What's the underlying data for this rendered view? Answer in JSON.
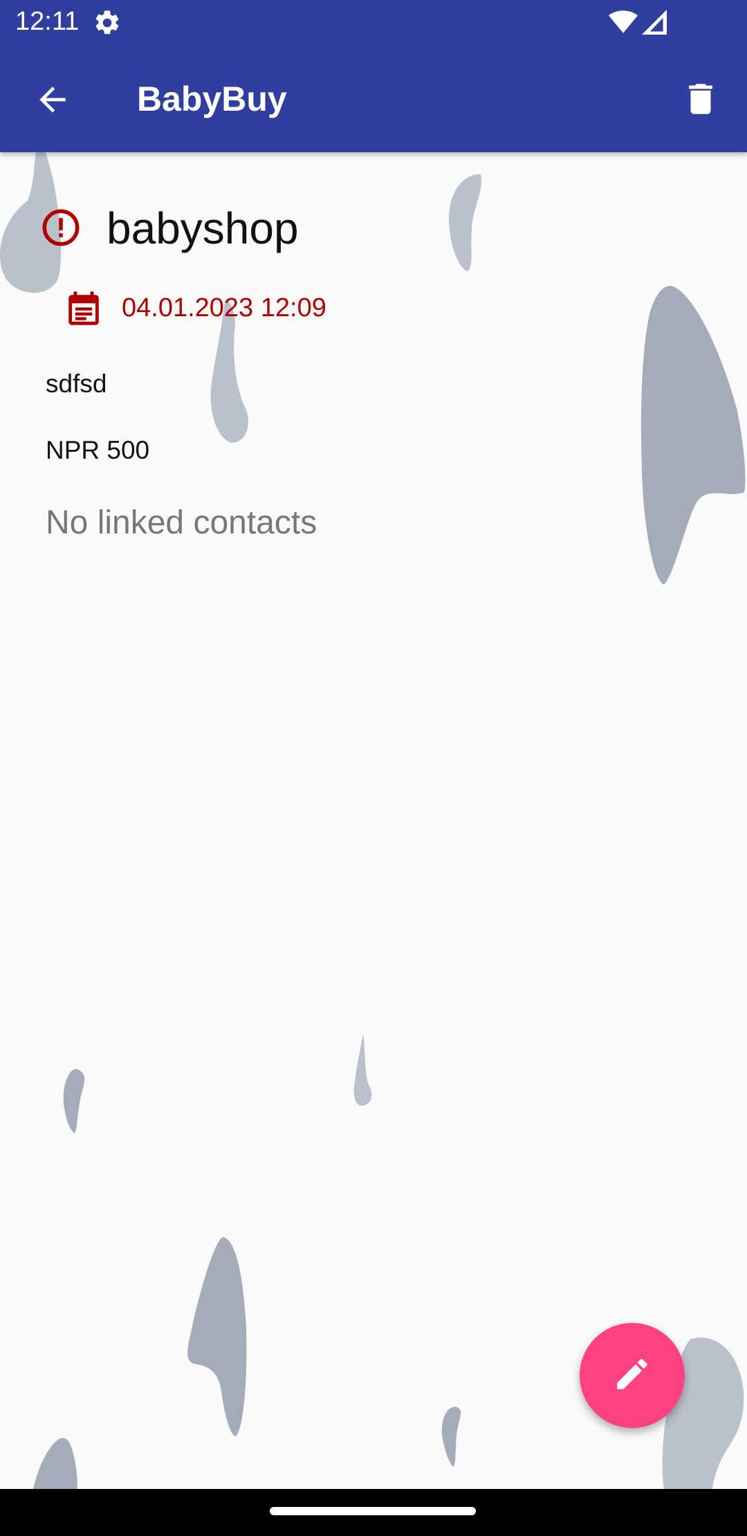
{
  "status_bar": {
    "time": "12:11",
    "icons": [
      "settings-gear-icon",
      "wifi-icon",
      "cell-signal-icon"
    ]
  },
  "app_bar": {
    "title": "BabyBuy",
    "back_icon": "arrow-back-icon",
    "delete_icon": "trash-icon"
  },
  "item": {
    "name": "babyshop",
    "status_icon": "alert-circle-icon",
    "date_icon": "calendar-icon",
    "date": "04.01.2023 12:09",
    "description": "sdfsd",
    "price": "NPR 500",
    "contacts": "No linked contacts"
  },
  "fab": {
    "icon": "pencil-edit-icon"
  },
  "colors": {
    "primary": "#303f9f",
    "accent": "#ff4081",
    "date_red": "#b00000",
    "blob": "#9aa3b3",
    "background": "#fafafa"
  }
}
